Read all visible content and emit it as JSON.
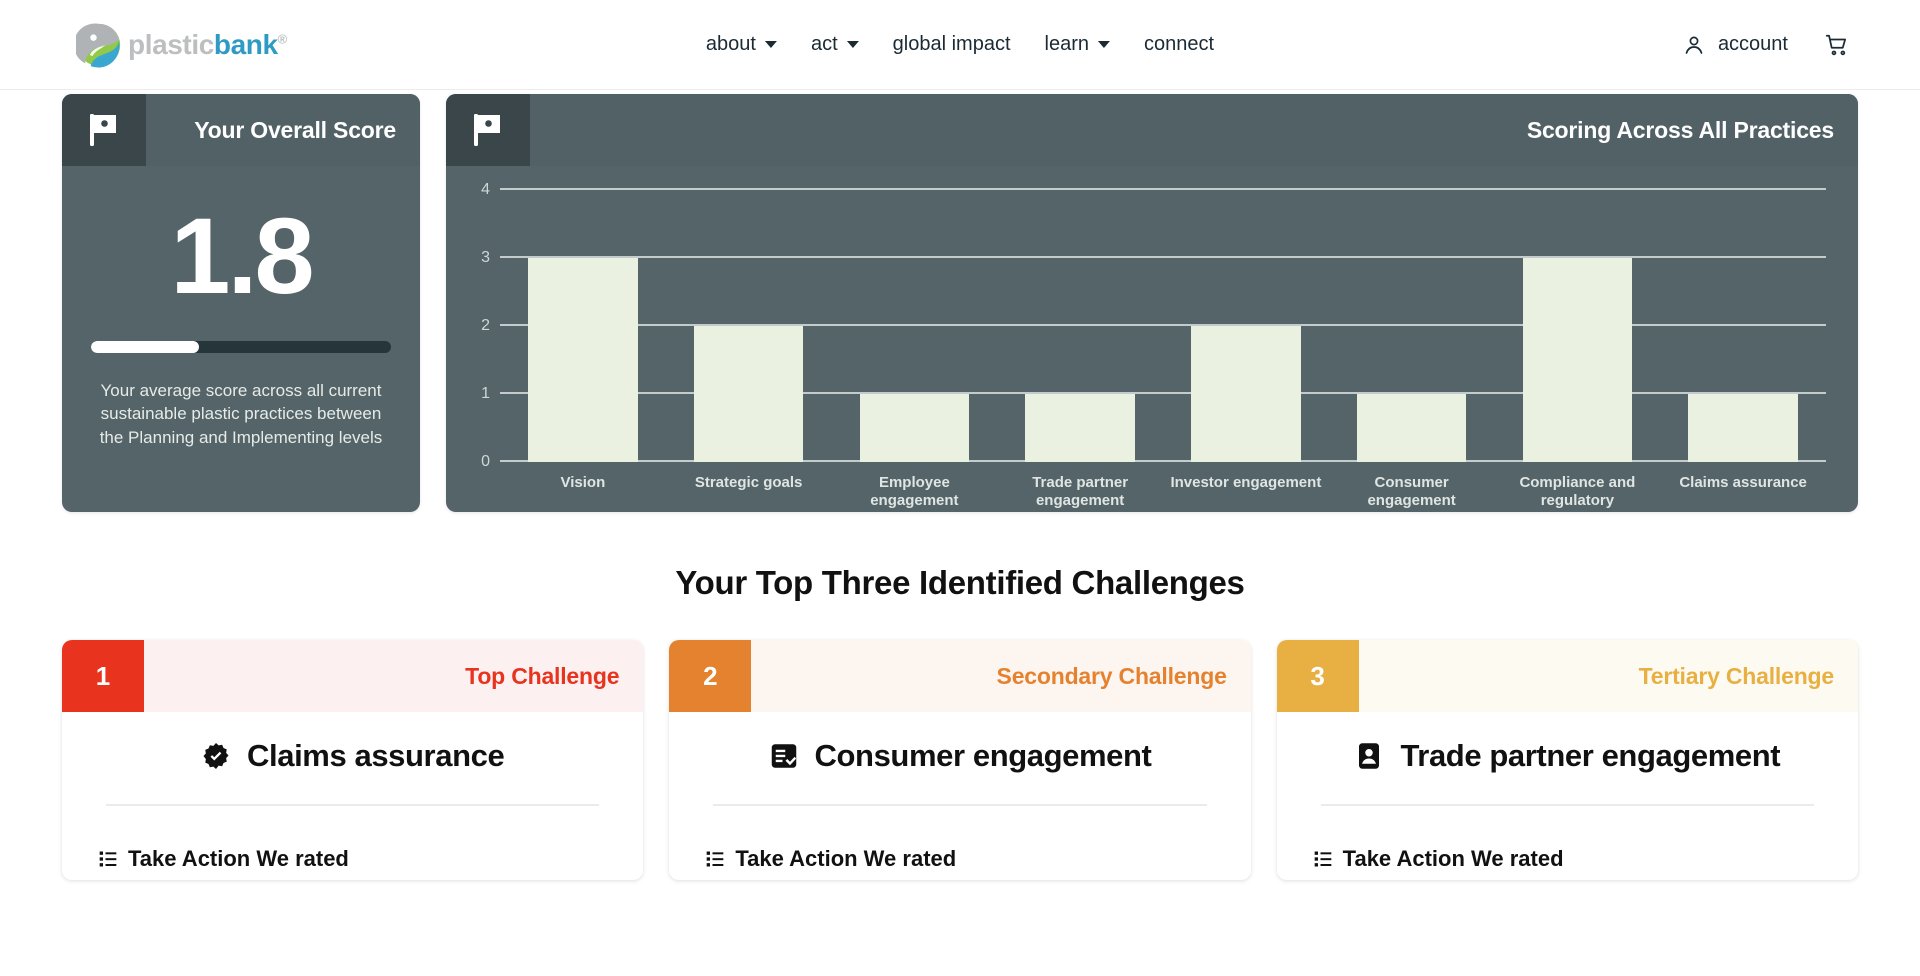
{
  "nav": {
    "logo": {
      "plastic": "plastic",
      "bank": "bank",
      "reg": "®"
    },
    "items": [
      {
        "label": "about",
        "caret": true
      },
      {
        "label": "act",
        "caret": true
      },
      {
        "label": "global impact",
        "caret": false
      },
      {
        "label": "learn",
        "caret": true
      },
      {
        "label": "connect",
        "caret": false
      }
    ],
    "account_label": "account",
    "account_icon": "person-icon",
    "cart_icon": "shopping-cart-icon"
  },
  "score_card": {
    "icon": "flag-icon",
    "title": "Your Overall Score",
    "value": "1.8",
    "progress_percent": 36,
    "description": "Your average score across all current sustainable plastic practices between the Planning and Implementing levels"
  },
  "chart_card": {
    "icon": "flag-icon",
    "title": "Scoring Across All Practices"
  },
  "chart_data": {
    "type": "bar",
    "title": "Scoring Across All Practices",
    "xlabel": "",
    "ylabel": "",
    "ylim": [
      0,
      4
    ],
    "yticks": [
      0,
      1,
      2,
      3,
      4
    ],
    "grid": true,
    "legend": "none",
    "bar_color": "#eaf1e0",
    "categories": [
      "Vision",
      "Strategic goals",
      "Employee engagement",
      "Trade partner engagement",
      "Investor engagement",
      "Consumer engagement",
      "Compliance and regulatory",
      "Claims assurance"
    ],
    "values": [
      3,
      2,
      1,
      1,
      2,
      1,
      3,
      1
    ]
  },
  "challenges": {
    "heading": "Your Top Three Identified Challenges",
    "cards": [
      {
        "number": "1",
        "kicker": "Top Challenge",
        "name": "Claims assurance",
        "icon": "badge-check-icon",
        "accent": "#E8331F",
        "kicker_color": "#E8331F",
        "head_bg": "#FCF1F0",
        "subheading": "Take Action We rated",
        "sub_icon": "list-icon"
      },
      {
        "number": "2",
        "kicker": "Secondary Challenge",
        "name": "Consumer engagement",
        "icon": "clipboard-check-icon",
        "accent": "#E5822F",
        "kicker_color": "#E5822F",
        "head_bg": "#FDF6F0",
        "subheading": "Take Action We rated",
        "sub_icon": "list-icon"
      },
      {
        "number": "3",
        "kicker": "Tertiary Challenge",
        "name": "Trade partner engagement",
        "icon": "contact-card-icon",
        "accent": "#E8B043",
        "kicker_color": "#E8B043",
        "head_bg": "#FDFAF2",
        "subheading": "Take Action We rated",
        "sub_icon": "list-icon"
      }
    ]
  }
}
